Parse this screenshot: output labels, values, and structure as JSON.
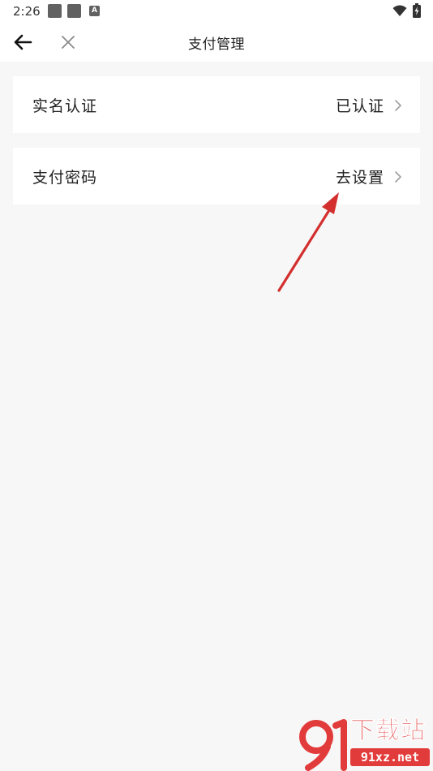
{
  "status_bar": {
    "time": "2:26",
    "notification_icons": [
      "gallery-icon",
      "gallery-icon",
      "a-icon"
    ],
    "a_icon_letter": "A",
    "system_icons": [
      "wifi-icon",
      "battery-charging-icon"
    ]
  },
  "header": {
    "title": "支付管理",
    "back_icon": "arrow-left-icon",
    "close_icon": "close-icon"
  },
  "rows": [
    {
      "label": "实名认证",
      "value": "已认证"
    },
    {
      "label": "支付密码",
      "value": "去设置"
    }
  ],
  "annotation": {
    "arrow_color": "#d32f2f"
  },
  "watermark": {
    "title": "下载站",
    "url": "91xz.net",
    "color": "#e23b3b"
  }
}
